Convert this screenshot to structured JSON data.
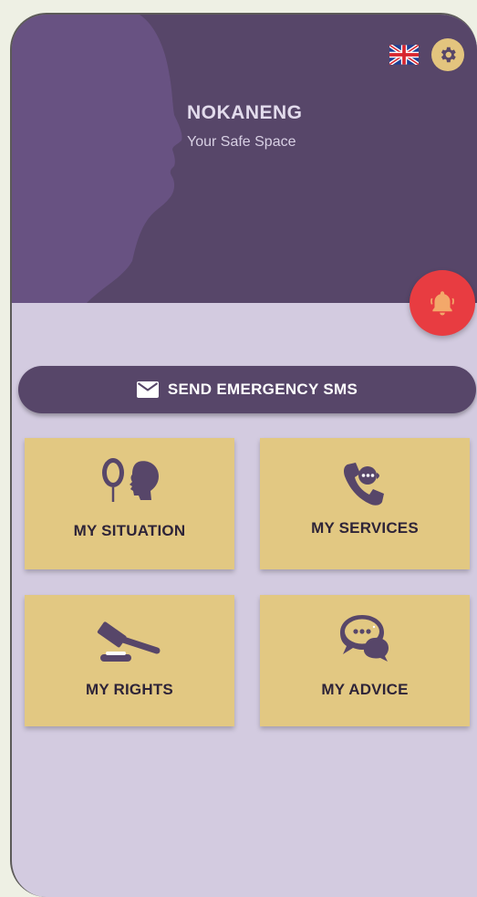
{
  "header": {
    "title": "NOKANENG",
    "subtitle": "Your Safe Space",
    "background_color": "#574669",
    "language_icon": "uk-flag-icon",
    "settings_icon": "gear-icon"
  },
  "alarm": {
    "icon": "bell-icon",
    "color": "#e83c41"
  },
  "emergency": {
    "label": "SEND EMERGENCY SMS",
    "icon": "envelope-icon"
  },
  "tiles": [
    {
      "label": "MY SITUATION",
      "icon": "mirror-face-icon"
    },
    {
      "label": "MY SERVICES",
      "icon": "phone-icon"
    },
    {
      "label": "MY RIGHTS",
      "icon": "gavel-icon"
    },
    {
      "label": "MY ADVICE",
      "icon": "chat-bubbles-icon"
    }
  ],
  "colors": {
    "tile": "#e2c882",
    "content_background": "#d3cbe0",
    "accent_gold": "#e3c47e"
  }
}
